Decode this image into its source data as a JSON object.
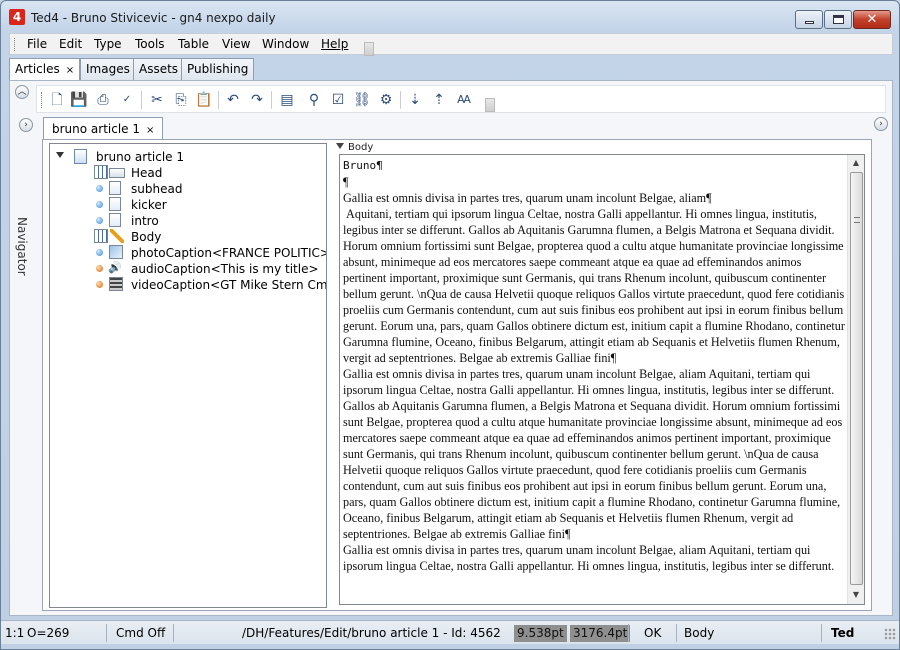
{
  "window": {
    "title": "Ted4 - Bruno Stivicevic - gn4 nexpo daily",
    "app_icon_glyph": "4",
    "close_glyph": "✕"
  },
  "menu": [
    "File",
    "Edit",
    "Type",
    "Tools",
    "Table",
    "View",
    "Window",
    "Help"
  ],
  "top_tabs": [
    {
      "label": "Articles",
      "close": "×"
    },
    {
      "label": "Images"
    },
    {
      "label": "Assets"
    },
    {
      "label": "Publishing"
    }
  ],
  "toolbar_icons": [
    "new-document-icon",
    "save-icon",
    "print-icon",
    "spellcheck-icon",
    "cut-icon",
    "copy-icon",
    "paste-icon",
    "undo-icon",
    "redo-icon",
    "layout-icon",
    "find-icon",
    "properties-icon",
    "link-icon",
    "tools-icon",
    "insert-field-icon",
    "move-field-icon",
    "text-style-icon"
  ],
  "navigator_label": "Navigator",
  "doc_tab": {
    "label": "bruno article 1",
    "close": "×"
  },
  "tree": {
    "root": "bruno article 1",
    "items": [
      {
        "label": "Head",
        "icon": "table-icon",
        "bullet": "none"
      },
      {
        "label": "subhead",
        "icon": "text-field-icon",
        "bullet": "blue"
      },
      {
        "label": "kicker",
        "icon": "text-field-icon",
        "bullet": "blue"
      },
      {
        "label": "intro",
        "icon": "text-field-icon",
        "bullet": "blue"
      },
      {
        "label": "Body",
        "icon": "body-edit-icon",
        "bullet": "none"
      },
      {
        "label": "photoCaption<FRANCE POLITIC>",
        "icon": "photo-icon",
        "bullet": "blue"
      },
      {
        "label": "audioCaption<This is my title>",
        "icon": "speaker-icon",
        "bullet": "orange"
      },
      {
        "label": "videoCaption<GT Mike Stern Cm>",
        "icon": "film-icon",
        "bullet": "orange"
      }
    ]
  },
  "editor": {
    "field_label": "Body",
    "first_line": "Bruno¶",
    "body": "¶\nGallia est omnis divisa in partes tres, quarum unam incolunt Belgae, aliam¶\n Aquitani, tertiam qui ipsorum lingua Celtae, nostra Galli appellantur. Hi omnes lingua, institutis, legibus inter se differunt. Gallos ab Aquitanis Garumna flumen, a Belgis Matrona et Sequana dividit. Horum omnium fortissimi sunt Belgae, propterea quod a cultu atque humanitate provinciae longissime absunt, minimeque ad eos mercatores saepe commeant atque ea quae ad effeminandos animos pertinent important, proximique sunt Germanis, qui trans Rhenum incolunt, quibuscum continenter bellum gerunt. \\nQua de causa Helvetii quoque reliquos Gallos virtute praecedunt, quod fere cotidianis proeliis cum Germanis contendunt, cum aut suis finibus eos prohibent aut ipsi in eorum finibus bellum gerunt. Eorum una, pars, quam Gallos obtinere dictum est, initium capit a flumine Rhodano, continetur Garumna flumine, Oceano, finibus Belgarum, attingit etiam ab Sequanis et Helvetiis flumen Rhenum, vergit ad septentriones. Belgae ab extremis Galliae fini¶\nGallia est omnis divisa in partes tres, quarum unam incolunt Belgae, aliam Aquitani, tertiam qui ipsorum lingua Celtae, nostra Galli appellantur. Hi omnes lingua, institutis, legibus inter se differunt. Gallos ab Aquitanis Garumna flumen, a Belgis Matrona et Sequana dividit. Horum omnium fortissimi sunt Belgae, propterea quod a cultu atque humanitate provinciae longissime absunt, minimeque ad eos mercatores saepe commeant atque ea quae ad effeminandos animos pertinent important, proximique sunt Germanis, qui trans Rhenum incolunt, quibuscum continenter bellum gerunt. \\nQua de causa Helvetii quoque reliquos Gallos virtute praecedunt, quod fere cotidianis proeliis cum Germanis contendunt, cum aut suis finibus eos prohibent aut ipsi in eorum finibus bellum gerunt. Eorum una, pars, quam Gallos obtinere dictum est, initium capit a flumine Rhodano, continetur Garumna flumine, Oceano, finibus Belgarum, attingit etiam ab Sequanis et Helvetiis flumen Rhenum, vergit ad septentriones. Belgae ab extremis Galliae fini¶\nGallia est omnis divisa in partes tres, quarum unam incolunt Belgae, aliam Aquitani, tertiam qui ipsorum lingua Celtae, nostra Galli appellantur. Hi omnes lingua, institutis, legibus inter se differunt."
  },
  "status": {
    "position": "1:1",
    "offset": "O=269",
    "cmd": "Cmd Off",
    "path": "/DH/Features/Edit/bruno article 1 - Id: 4562",
    "size1": "9.538pt",
    "size2": "3176.4pt",
    "ok": "OK",
    "field": "Body",
    "app": "Ted"
  },
  "colors": {
    "title_bg": "#c3d4e8",
    "close_button": "#c2402c",
    "status_dark": "#8f8f8f"
  }
}
